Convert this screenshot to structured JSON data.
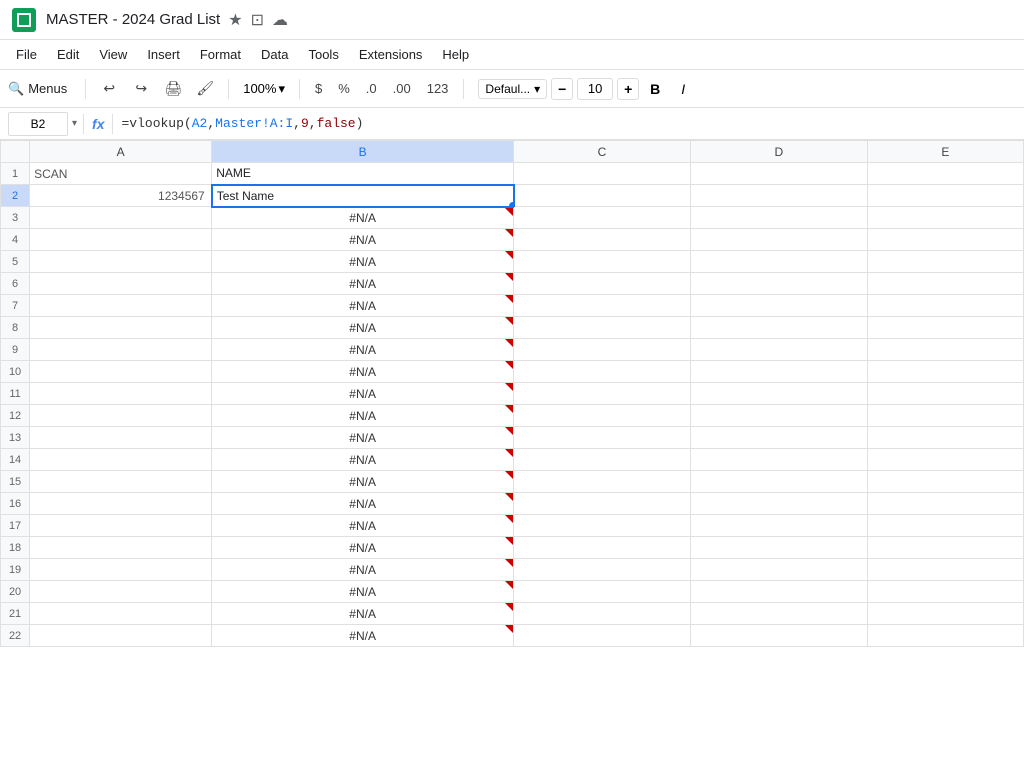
{
  "titleBar": {
    "appName": "MASTER - 2024 Grad List",
    "starIcon": "★",
    "folderIcon": "⊡",
    "cloudIcon": "☁"
  },
  "menuBar": {
    "items": [
      "File",
      "Edit",
      "View",
      "Insert",
      "Format",
      "Data",
      "Tools",
      "Extensions",
      "Help"
    ]
  },
  "toolbar": {
    "searchLabel": "Menus",
    "undoIcon": "↩",
    "redoIcon": "↪",
    "printIcon": "🖨",
    "formatPaintIcon": "🖌",
    "zoomLevel": "100%",
    "zoomArrow": "▾",
    "currencySymbol": "$",
    "percentSymbol": "%",
    "decimalLess": ".0",
    "decimalMore": ".00",
    "numberFormat": "123",
    "fontName": "Defaul...",
    "fontArrow": "▾",
    "fontSizeMinus": "−",
    "fontSize": "10",
    "fontSizePlus": "+",
    "boldLabel": "B",
    "italicLabel": "I"
  },
  "formulaBar": {
    "cellRef": "B2",
    "dropArrow": "▾",
    "fxLabel": "fx",
    "formula": "=vlookup(A2,Master!A:I,9,false)"
  },
  "columns": {
    "headers": [
      "",
      "A",
      "B",
      "C",
      "D",
      "E"
    ],
    "widths": [
      28,
      175,
      290,
      170,
      170,
      150
    ]
  },
  "rows": [
    {
      "num": "1",
      "a": "SCAN",
      "b": "NAME",
      "c": "",
      "d": "",
      "e": ""
    },
    {
      "num": "2",
      "a": "1234567",
      "b": "Test Name",
      "c": "",
      "d": "",
      "e": ""
    },
    {
      "num": "3",
      "a": "",
      "b": "#N/A",
      "c": "",
      "d": "",
      "e": ""
    },
    {
      "num": "4",
      "a": "",
      "b": "#N/A",
      "c": "",
      "d": "",
      "e": ""
    },
    {
      "num": "5",
      "a": "",
      "b": "#N/A",
      "c": "",
      "d": "",
      "e": ""
    },
    {
      "num": "6",
      "a": "",
      "b": "#N/A",
      "c": "",
      "d": "",
      "e": ""
    },
    {
      "num": "7",
      "a": "",
      "b": "#N/A",
      "c": "",
      "d": "",
      "e": ""
    },
    {
      "num": "8",
      "a": "",
      "b": "#N/A",
      "c": "",
      "d": "",
      "e": ""
    },
    {
      "num": "9",
      "a": "",
      "b": "#N/A",
      "c": "",
      "d": "",
      "e": ""
    },
    {
      "num": "10",
      "a": "",
      "b": "#N/A",
      "c": "",
      "d": "",
      "e": ""
    },
    {
      "num": "11",
      "a": "",
      "b": "#N/A",
      "c": "",
      "d": "",
      "e": ""
    },
    {
      "num": "12",
      "a": "",
      "b": "#N/A",
      "c": "",
      "d": "",
      "e": ""
    },
    {
      "num": "13",
      "a": "",
      "b": "#N/A",
      "c": "",
      "d": "",
      "e": ""
    },
    {
      "num": "14",
      "a": "",
      "b": "#N/A",
      "c": "",
      "d": "",
      "e": ""
    },
    {
      "num": "15",
      "a": "",
      "b": "#N/A",
      "c": "",
      "d": "",
      "e": ""
    },
    {
      "num": "16",
      "a": "",
      "b": "#N/A",
      "c": "",
      "d": "",
      "e": ""
    },
    {
      "num": "17",
      "a": "",
      "b": "#N/A",
      "c": "",
      "d": "",
      "e": ""
    },
    {
      "num": "18",
      "a": "",
      "b": "#N/A",
      "c": "",
      "d": "",
      "e": ""
    },
    {
      "num": "19",
      "a": "",
      "b": "#N/A",
      "c": "",
      "d": "",
      "e": ""
    },
    {
      "num": "20",
      "a": "",
      "b": "#N/A",
      "c": "",
      "d": "",
      "e": ""
    },
    {
      "num": "21",
      "a": "",
      "b": "#N/A",
      "c": "",
      "d": "",
      "e": ""
    },
    {
      "num": "22",
      "a": "",
      "b": "#N/A",
      "c": "",
      "d": "",
      "e": ""
    }
  ],
  "colors": {
    "activeColBg": "#c9daf8",
    "headerBg": "#f8f9fa",
    "activeBorder": "#1a73e8",
    "errorTriangle": "#cc0000",
    "appGreen": "#0f9d58"
  }
}
